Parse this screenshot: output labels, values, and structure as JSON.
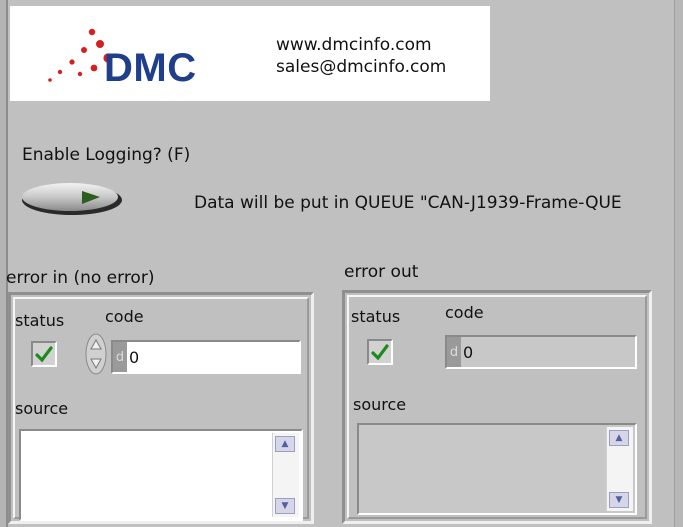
{
  "logo": {
    "brand": "DMC",
    "website": "www.dmcinfo.com",
    "email": "sales@dmcinfo.com",
    "brand_color": "#1f3f8c",
    "dot_color": "#d42020"
  },
  "logging": {
    "label": "Enable Logging? (F)",
    "state": false
  },
  "queue_message": "Data will be put in QUEUE \"CAN-J1939-Frame-QUE",
  "error_in": {
    "label": "error in (no error)",
    "status_label": "status",
    "code_label": "code",
    "radix": "d",
    "code_value": "0",
    "source_label": "source",
    "source_value": "",
    "status_checked": true
  },
  "error_out": {
    "label": "error out",
    "status_label": "status",
    "code_label": "code",
    "radix": "d",
    "code_value": "0",
    "source_label": "source",
    "source_value": "",
    "status_checked": true
  },
  "icons": {
    "check": "check-icon",
    "up": "scroll-up-icon",
    "down": "scroll-down-icon",
    "spin": "spinner-icon"
  }
}
